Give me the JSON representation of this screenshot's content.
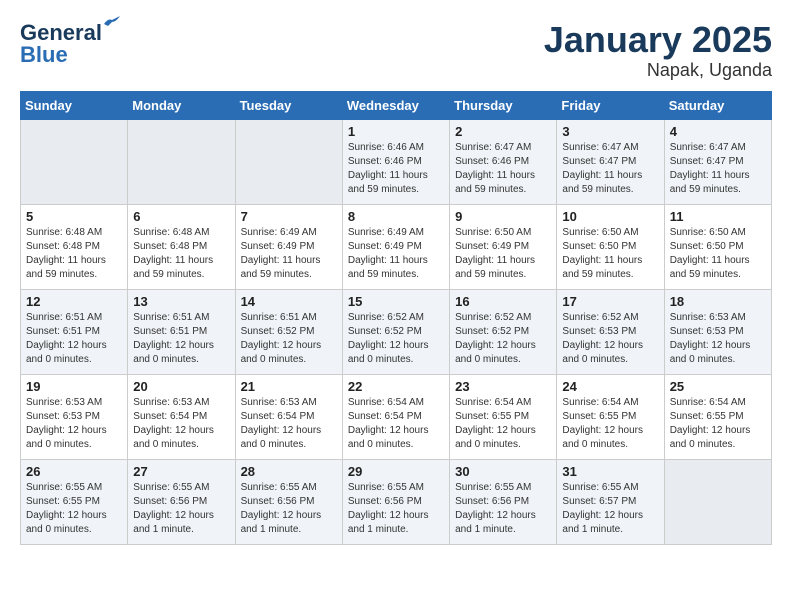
{
  "logo": {
    "line1": "General",
    "line2": "Blue"
  },
  "title": "January 2025",
  "subtitle": "Napak, Uganda",
  "weekdays": [
    "Sunday",
    "Monday",
    "Tuesday",
    "Wednesday",
    "Thursday",
    "Friday",
    "Saturday"
  ],
  "weeks": [
    [
      {
        "day": "",
        "info": ""
      },
      {
        "day": "",
        "info": ""
      },
      {
        "day": "",
        "info": ""
      },
      {
        "day": "1",
        "info": "Sunrise: 6:46 AM\nSunset: 6:46 PM\nDaylight: 11 hours\nand 59 minutes."
      },
      {
        "day": "2",
        "info": "Sunrise: 6:47 AM\nSunset: 6:46 PM\nDaylight: 11 hours\nand 59 minutes."
      },
      {
        "day": "3",
        "info": "Sunrise: 6:47 AM\nSunset: 6:47 PM\nDaylight: 11 hours\nand 59 minutes."
      },
      {
        "day": "4",
        "info": "Sunrise: 6:47 AM\nSunset: 6:47 PM\nDaylight: 11 hours\nand 59 minutes."
      }
    ],
    [
      {
        "day": "5",
        "info": "Sunrise: 6:48 AM\nSunset: 6:48 PM\nDaylight: 11 hours\nand 59 minutes."
      },
      {
        "day": "6",
        "info": "Sunrise: 6:48 AM\nSunset: 6:48 PM\nDaylight: 11 hours\nand 59 minutes."
      },
      {
        "day": "7",
        "info": "Sunrise: 6:49 AM\nSunset: 6:49 PM\nDaylight: 11 hours\nand 59 minutes."
      },
      {
        "day": "8",
        "info": "Sunrise: 6:49 AM\nSunset: 6:49 PM\nDaylight: 11 hours\nand 59 minutes."
      },
      {
        "day": "9",
        "info": "Sunrise: 6:50 AM\nSunset: 6:49 PM\nDaylight: 11 hours\nand 59 minutes."
      },
      {
        "day": "10",
        "info": "Sunrise: 6:50 AM\nSunset: 6:50 PM\nDaylight: 11 hours\nand 59 minutes."
      },
      {
        "day": "11",
        "info": "Sunrise: 6:50 AM\nSunset: 6:50 PM\nDaylight: 11 hours\nand 59 minutes."
      }
    ],
    [
      {
        "day": "12",
        "info": "Sunrise: 6:51 AM\nSunset: 6:51 PM\nDaylight: 12 hours\nand 0 minutes."
      },
      {
        "day": "13",
        "info": "Sunrise: 6:51 AM\nSunset: 6:51 PM\nDaylight: 12 hours\nand 0 minutes."
      },
      {
        "day": "14",
        "info": "Sunrise: 6:51 AM\nSunset: 6:52 PM\nDaylight: 12 hours\nand 0 minutes."
      },
      {
        "day": "15",
        "info": "Sunrise: 6:52 AM\nSunset: 6:52 PM\nDaylight: 12 hours\nand 0 minutes."
      },
      {
        "day": "16",
        "info": "Sunrise: 6:52 AM\nSunset: 6:52 PM\nDaylight: 12 hours\nand 0 minutes."
      },
      {
        "day": "17",
        "info": "Sunrise: 6:52 AM\nSunset: 6:53 PM\nDaylight: 12 hours\nand 0 minutes."
      },
      {
        "day": "18",
        "info": "Sunrise: 6:53 AM\nSunset: 6:53 PM\nDaylight: 12 hours\nand 0 minutes."
      }
    ],
    [
      {
        "day": "19",
        "info": "Sunrise: 6:53 AM\nSunset: 6:53 PM\nDaylight: 12 hours\nand 0 minutes."
      },
      {
        "day": "20",
        "info": "Sunrise: 6:53 AM\nSunset: 6:54 PM\nDaylight: 12 hours\nand 0 minutes."
      },
      {
        "day": "21",
        "info": "Sunrise: 6:53 AM\nSunset: 6:54 PM\nDaylight: 12 hours\nand 0 minutes."
      },
      {
        "day": "22",
        "info": "Sunrise: 6:54 AM\nSunset: 6:54 PM\nDaylight: 12 hours\nand 0 minutes."
      },
      {
        "day": "23",
        "info": "Sunrise: 6:54 AM\nSunset: 6:55 PM\nDaylight: 12 hours\nand 0 minutes."
      },
      {
        "day": "24",
        "info": "Sunrise: 6:54 AM\nSunset: 6:55 PM\nDaylight: 12 hours\nand 0 minutes."
      },
      {
        "day": "25",
        "info": "Sunrise: 6:54 AM\nSunset: 6:55 PM\nDaylight: 12 hours\nand 0 minutes."
      }
    ],
    [
      {
        "day": "26",
        "info": "Sunrise: 6:55 AM\nSunset: 6:55 PM\nDaylight: 12 hours\nand 0 minutes."
      },
      {
        "day": "27",
        "info": "Sunrise: 6:55 AM\nSunset: 6:56 PM\nDaylight: 12 hours\nand 1 minute."
      },
      {
        "day": "28",
        "info": "Sunrise: 6:55 AM\nSunset: 6:56 PM\nDaylight: 12 hours\nand 1 minute."
      },
      {
        "day": "29",
        "info": "Sunrise: 6:55 AM\nSunset: 6:56 PM\nDaylight: 12 hours\nand 1 minute."
      },
      {
        "day": "30",
        "info": "Sunrise: 6:55 AM\nSunset: 6:56 PM\nDaylight: 12 hours\nand 1 minute."
      },
      {
        "day": "31",
        "info": "Sunrise: 6:55 AM\nSunset: 6:57 PM\nDaylight: 12 hours\nand 1 minute."
      },
      {
        "day": "",
        "info": ""
      }
    ]
  ]
}
